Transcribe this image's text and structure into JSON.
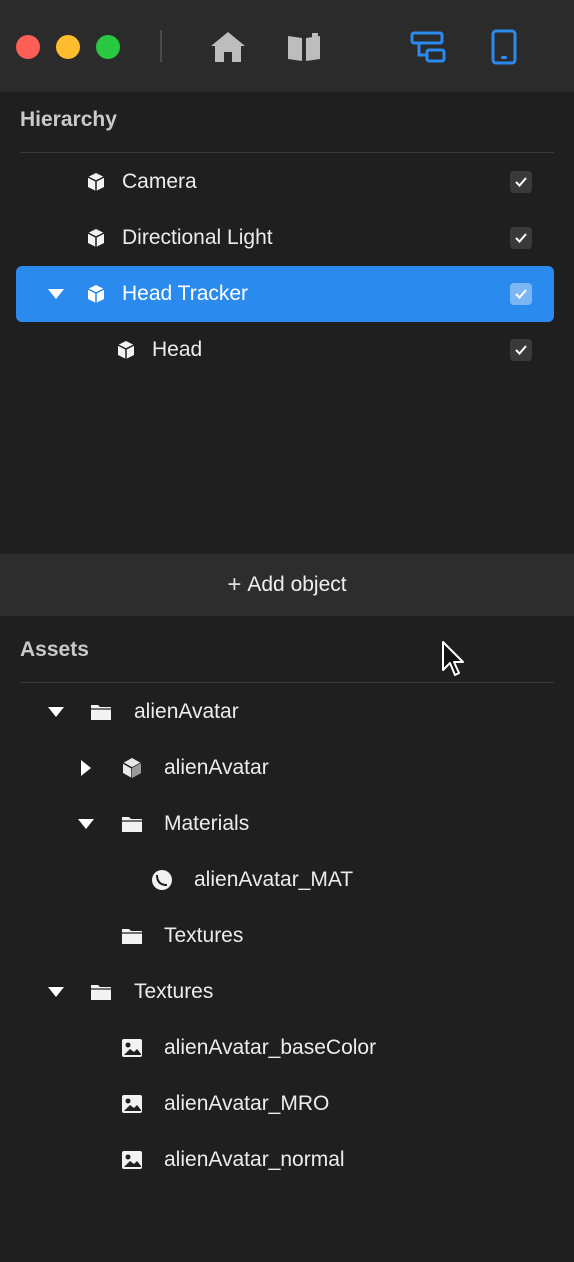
{
  "toolbar": {
    "icons": [
      "home-icon",
      "book-icon",
      "layout-icon",
      "device-icon"
    ],
    "accent": "#2a8aee"
  },
  "hierarchy": {
    "title": "Hierarchy",
    "items": [
      {
        "label": "Camera",
        "checked": true
      },
      {
        "label": "Directional Light",
        "checked": true
      },
      {
        "label": "Head Tracker",
        "checked": true,
        "selected": true,
        "expanded": true
      },
      {
        "label": "Head",
        "checked": true
      }
    ]
  },
  "add_object": {
    "label": "Add object",
    "icon": "plus-icon"
  },
  "assets": {
    "title": "Assets",
    "items": [
      {
        "label": "alienAvatar",
        "type": "folder",
        "expanded": true
      },
      {
        "label": "alienAvatar",
        "type": "mesh",
        "expanded": false
      },
      {
        "label": "Materials",
        "type": "folder",
        "expanded": true
      },
      {
        "label": "alienAvatar_MAT",
        "type": "material"
      },
      {
        "label": "Textures",
        "type": "folder"
      },
      {
        "label": "Textures",
        "type": "folder",
        "expanded": true
      },
      {
        "label": "alienAvatar_baseColor",
        "type": "image"
      },
      {
        "label": "alienAvatar_MRO",
        "type": "image"
      },
      {
        "label": "alienAvatar_normal",
        "type": "image"
      }
    ]
  }
}
